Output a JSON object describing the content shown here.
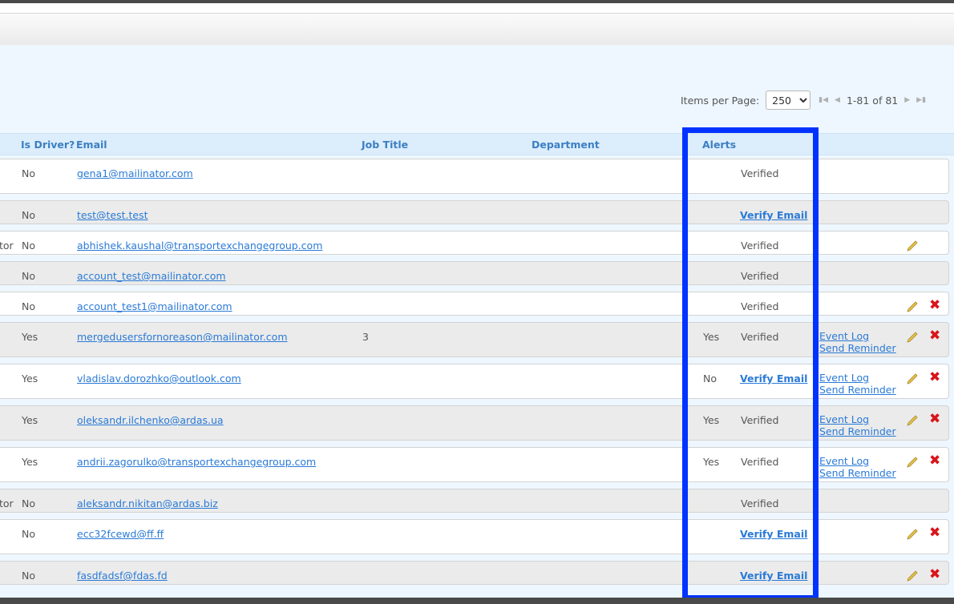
{
  "pager": {
    "label": "Items per Page:",
    "per_page": "250",
    "range": "1-81 of 81",
    "first_icon": "first-page-icon",
    "prev_icon": "prev-page-icon",
    "next_icon": "next-page-icon",
    "last_icon": "last-page-icon"
  },
  "columns": {
    "is_driver": "Is Driver?",
    "email": "Email",
    "job_title": "Job Title",
    "department": "Department",
    "alerts": "Alerts"
  },
  "rows": [
    {
      "prefix": "",
      "driver": "No",
      "email": "gena1@mailinator.com",
      "job": "",
      "alerts": "",
      "status": "Verified",
      "verify_link": false,
      "event_log": "",
      "reminder": "",
      "edit": false,
      "delete": false
    },
    {
      "prefix": "",
      "driver": "No",
      "email": "test@test.test",
      "job": "",
      "alerts": "",
      "status": "Verify Email",
      "verify_link": true,
      "event_log": "",
      "reminder": "",
      "edit": false,
      "delete": false
    },
    {
      "prefix": "tor",
      "driver": "No",
      "email": "abhishek.kaushal@transportexchangegroup.com",
      "job": "",
      "alerts": "",
      "status": "Verified",
      "verify_link": false,
      "event_log": "",
      "reminder": "",
      "edit": true,
      "delete": false
    },
    {
      "prefix": "",
      "driver": "No",
      "email": "account_test@mailinator.com",
      "job": "",
      "alerts": "",
      "status": "Verified",
      "verify_link": false,
      "event_log": "",
      "reminder": "",
      "edit": false,
      "delete": false
    },
    {
      "prefix": "",
      "driver": "No",
      "email": "account_test1@mailinator.com",
      "job": "",
      "alerts": "",
      "status": "Verified",
      "verify_link": false,
      "event_log": "",
      "reminder": "",
      "edit": true,
      "delete": true
    },
    {
      "prefix": "",
      "driver": "Yes",
      "email": "mergedusersfornoreason@mailinator.com",
      "job": "3",
      "alerts": "Yes",
      "status": "Verified",
      "verify_link": false,
      "event_log": "Event Log",
      "reminder": "Send Reminder",
      "edit": true,
      "delete": true
    },
    {
      "prefix": "",
      "driver": "Yes",
      "email": "vladislav.dorozhko@outlook.com",
      "job": "",
      "alerts": "No",
      "status": "Verify Email",
      "verify_link": true,
      "event_log": "Event Log",
      "reminder": "Send Reminder",
      "edit": true,
      "delete": true
    },
    {
      "prefix": "",
      "driver": "Yes",
      "email": "oleksandr.ilchenko@ardas.ua",
      "job": "",
      "alerts": "Yes",
      "status": "Verified",
      "verify_link": false,
      "event_log": "Event Log",
      "reminder": "Send Reminder",
      "edit": true,
      "delete": true
    },
    {
      "prefix": "",
      "driver": "Yes",
      "email": "andrii.zagorulko@transportexchangegroup.com",
      "job": "",
      "alerts": "Yes",
      "status": "Verified",
      "verify_link": false,
      "event_log": "Event Log",
      "reminder": "Send Reminder",
      "edit": true,
      "delete": true
    },
    {
      "prefix": "tor",
      "driver": "No",
      "email": "aleksandr.nikitan@ardas.biz",
      "job": "",
      "alerts": "",
      "status": "Verified",
      "verify_link": false,
      "event_log": "",
      "reminder": "",
      "edit": false,
      "delete": false
    },
    {
      "prefix": "",
      "driver": "No",
      "email": "ecc32fcewd@ff.ff",
      "job": "",
      "alerts": "",
      "status": "Verify Email",
      "verify_link": true,
      "event_log": "",
      "reminder": "",
      "edit": true,
      "delete": true
    },
    {
      "prefix": "",
      "driver": "No",
      "email": "fasdfadsf@fdas.fd",
      "job": "",
      "alerts": "",
      "status": "Verify Email",
      "verify_link": true,
      "event_log": "",
      "reminder": "",
      "edit": true,
      "delete": true
    }
  ],
  "icons": {
    "edit": "pencil-icon",
    "delete": "close-icon"
  },
  "colors": {
    "accent": "#2a7ad6",
    "header_bg": "#dcedfb",
    "highlight": "#0033ff",
    "delete": "#d8151b"
  }
}
